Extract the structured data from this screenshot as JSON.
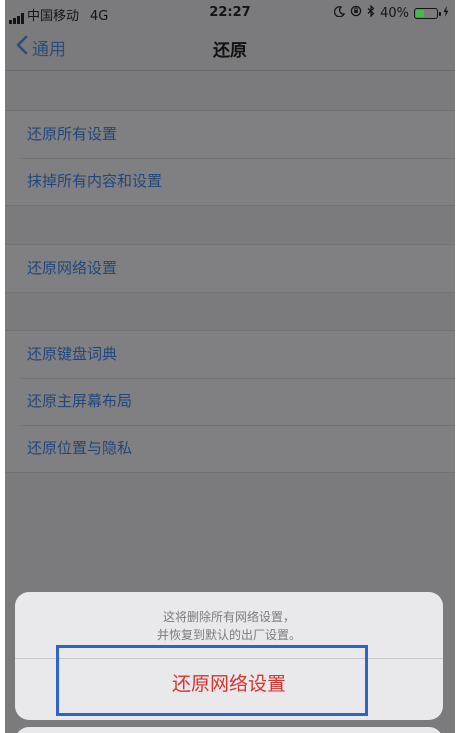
{
  "status_bar": {
    "carrier": "中国移动",
    "network": "4G",
    "time": "22:27",
    "battery_percent_label": "40%",
    "battery_level": 0.4,
    "icons": [
      "moon-icon",
      "orientation-lock-icon",
      "bluetooth-icon",
      "charging-icon"
    ]
  },
  "nav": {
    "back_label": "通用",
    "title": "还原"
  },
  "groups": [
    {
      "items": [
        "还原所有设置",
        "抹掉所有内容和设置"
      ]
    },
    {
      "items": [
        "还原网络设置"
      ]
    },
    {
      "items": [
        "还原键盘词典",
        "还原主屏幕布局",
        "还原位置与隐私"
      ]
    }
  ],
  "action_sheet": {
    "message_line1": "这将删除所有网络设置，",
    "message_line2": "并恢复到默认的出厂设置。",
    "confirm_label": "还原网络设置"
  },
  "colors": {
    "link": "#23467a",
    "destructive": "#d8352e",
    "highlight": "#2e63c8",
    "battery": "#45b84b"
  }
}
